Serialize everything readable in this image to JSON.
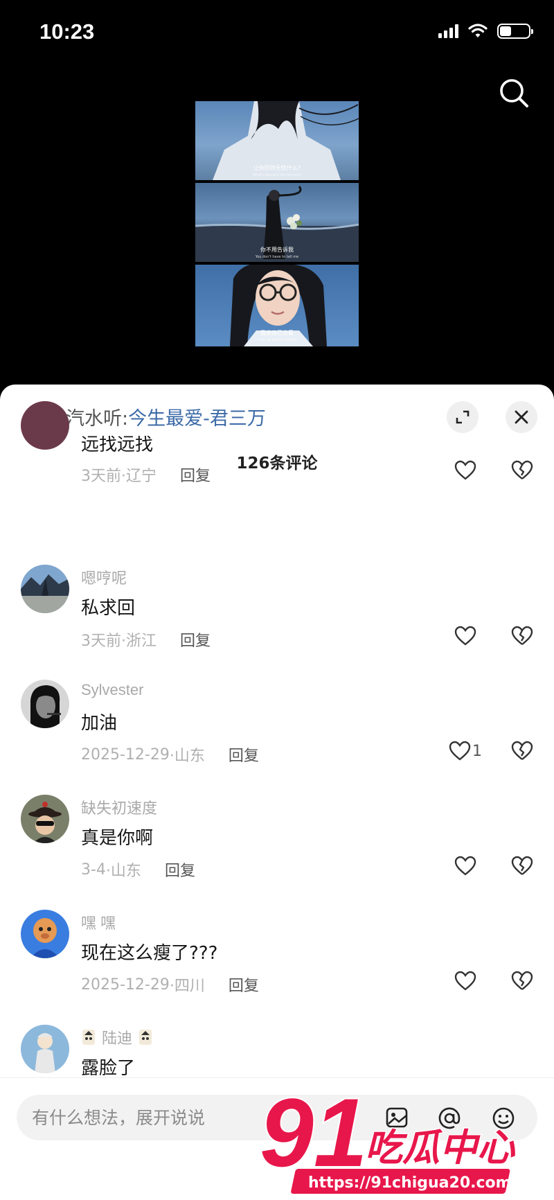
{
  "status": {
    "time": "10:23"
  },
  "video": {
    "captions": [
      {
        "zh": "让你回到无忧什么?",
        "en": "What's beyond the horizon?"
      },
      {
        "zh": "你不用告诉我",
        "en": "You don't have to tell me"
      },
      {
        "zh": "我会自己去看",
        "en": "I will go see for myself"
      }
    ]
  },
  "music": {
    "prefix": "去汽水听:",
    "title": "今生最爱-君三万"
  },
  "comments_header": "126条评论",
  "comments": [
    {
      "user": "",
      "text": "远找远找",
      "time": "3天前",
      "location": "·辽宁",
      "reply": "回复",
      "likes": ""
    },
    {
      "user": "嗯哼呢",
      "text": "私求回",
      "time": "3天前",
      "location": "·浙江",
      "reply": "回复",
      "likes": ""
    },
    {
      "user": "Sylvester",
      "text": "加油",
      "time": "2025-12-29",
      "location": "·山东",
      "reply": "回复",
      "likes": "1"
    },
    {
      "user": "缺失初速度",
      "text": "真是你啊",
      "time": "3-4",
      "location": "·山东",
      "reply": "回复",
      "likes": ""
    },
    {
      "user": "嘿 嘿",
      "text": "现在这么瘦了???",
      "time": "2025-12-29",
      "location": "·四川",
      "reply": "回复",
      "likes": ""
    },
    {
      "user": "陆迪",
      "text": "露脸了",
      "time": "",
      "location": "",
      "reply": "",
      "likes": ""
    }
  ],
  "input": {
    "placeholder": "有什么想法，展开说说"
  },
  "watermark": {
    "number": "91",
    "brand": "吃瓜中心",
    "url": "https://91chigua20.com"
  },
  "colors": {
    "music_link": "#3b6aa7",
    "watermark_red": "#e8174b"
  }
}
